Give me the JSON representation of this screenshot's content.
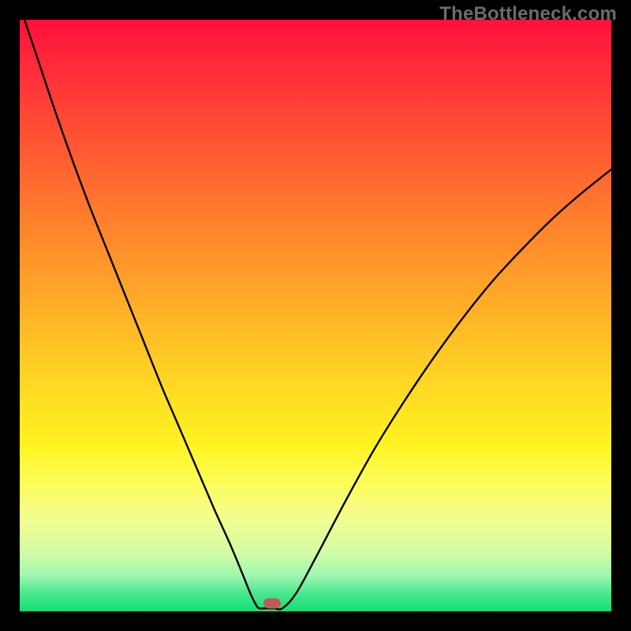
{
  "watermark": "TheBottleneck.com",
  "chart_data": {
    "type": "line",
    "title": "",
    "xlabel": "",
    "ylabel": "",
    "xlim": [
      0,
      100
    ],
    "ylim": [
      0,
      100
    ],
    "grid": false,
    "series": [
      {
        "name": "curve",
        "color": "#000000",
        "x": [
          0.8,
          3,
          6,
          9,
          12,
          15,
          18,
          21,
          24,
          27,
          30,
          33,
          35.5,
          37.5,
          39,
          40,
          40.5,
          41.5,
          43,
          44.4,
          46.7,
          50,
          55,
          60,
          65,
          70,
          75,
          80,
          85,
          90,
          95,
          100
        ],
        "y": [
          100,
          93.5,
          84.5,
          76,
          68,
          60.5,
          53,
          45.5,
          38,
          31,
          24,
          17,
          11.5,
          6.7,
          3,
          1,
          0.5,
          0.5,
          0.5,
          0.5,
          3,
          9,
          18.5,
          27.5,
          35.5,
          42.9,
          49.7,
          55.9,
          61.3,
          66.3,
          70.7,
          74.7
        ]
      }
    ],
    "marker": {
      "x": 42.7,
      "y": 1.3,
      "color": "#bf5b58"
    },
    "background_gradient": {
      "top": "#ff103d",
      "bottom": "#14de75"
    }
  }
}
